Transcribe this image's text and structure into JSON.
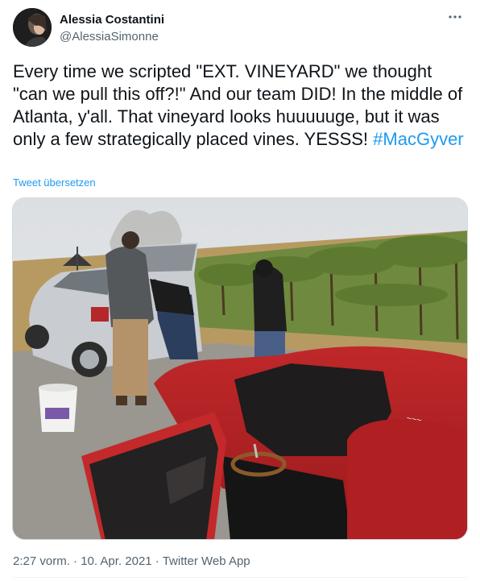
{
  "author": {
    "display_name": "Alessia Costantini",
    "handle": "@AlessiaSimonne"
  },
  "tweet": {
    "text": "Every time we scripted \"EXT. VINEYARD\" we thought \"can we pull this off?!\" And our team DID! In the middle of Atlanta, y'all. That vineyard looks huuuuuge, but it was only a few strategically placed vines. YESSS! ",
    "hashtag": "#MacGyver",
    "translate_label": "Tweet übersetzen"
  },
  "meta": {
    "time": "2:27 vorm.",
    "separator": " · ",
    "date": "10. Apr. 2021",
    "app": "Twitter Web App"
  },
  "icons": {
    "more": "more-horizontal-icon"
  },
  "colors": {
    "link": "#1d9bf0",
    "secondary_text": "#536471",
    "primary_text": "#0f1419"
  }
}
